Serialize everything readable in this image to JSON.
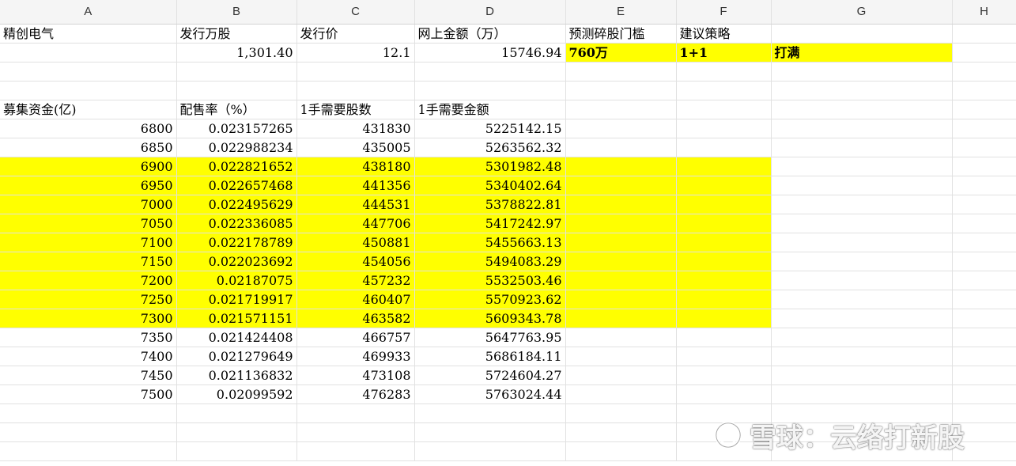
{
  "columns": [
    "A",
    "B",
    "C",
    "D",
    "E",
    "F",
    "G",
    "H"
  ],
  "row1": {
    "a": "精创电气",
    "b": "发行万股",
    "c": "发行价",
    "d": "网上金额（万）",
    "e": "预测碎股门槛",
    "f": "建议策略"
  },
  "row2": {
    "b": "1,301.40",
    "c": "12.1",
    "d": "15746.94",
    "e": "760万",
    "f": "1+1",
    "g": "打满"
  },
  "table_header": {
    "a": "募集资金(亿)",
    "b": "配售率（%）",
    "c": "1手需要股数",
    "d": "1手需要金额"
  },
  "rows": [
    {
      "a": "6800",
      "b": "0.023157265",
      "c": "431830",
      "d": "5225142.15",
      "hl": false
    },
    {
      "a": "6850",
      "b": "0.022988234",
      "c": "435005",
      "d": "5263562.32",
      "hl": false
    },
    {
      "a": "6900",
      "b": "0.022821652",
      "c": "438180",
      "d": "5301982.48",
      "hl": true
    },
    {
      "a": "6950",
      "b": "0.022657468",
      "c": "441356",
      "d": "5340402.64",
      "hl": true
    },
    {
      "a": "7000",
      "b": "0.022495629",
      "c": "444531",
      "d": "5378822.81",
      "hl": true
    },
    {
      "a": "7050",
      "b": "0.022336085",
      "c": "447706",
      "d": "5417242.97",
      "hl": true
    },
    {
      "a": "7100",
      "b": "0.022178789",
      "c": "450881",
      "d": "5455663.13",
      "hl": true
    },
    {
      "a": "7150",
      "b": "0.022023692",
      "c": "454056",
      "d": "5494083.29",
      "hl": true
    },
    {
      "a": "7200",
      "b": "0.02187075",
      "c": "457232",
      "d": "5532503.46",
      "hl": true
    },
    {
      "a": "7250",
      "b": "0.021719917",
      "c": "460407",
      "d": "5570923.62",
      "hl": true
    },
    {
      "a": "7300",
      "b": "0.021571151",
      "c": "463582",
      "d": "5609343.78",
      "hl": true
    },
    {
      "a": "7350",
      "b": "0.021424408",
      "c": "466757",
      "d": "5647763.95",
      "hl": false
    },
    {
      "a": "7400",
      "b": "0.021279649",
      "c": "469933",
      "d": "5686184.11",
      "hl": false
    },
    {
      "a": "7450",
      "b": "0.021136832",
      "c": "473108",
      "d": "5724604.27",
      "hl": false
    },
    {
      "a": "7500",
      "b": "0.02099592",
      "c": "476283",
      "d": "5763024.44",
      "hl": false
    }
  ],
  "empty_rows_after": 3,
  "colors": {
    "highlight": "#ffff00",
    "price_text": "#e02020"
  },
  "watermark": {
    "icon": "snowball-logo-icon",
    "text": "雪球：云络打新股"
  }
}
